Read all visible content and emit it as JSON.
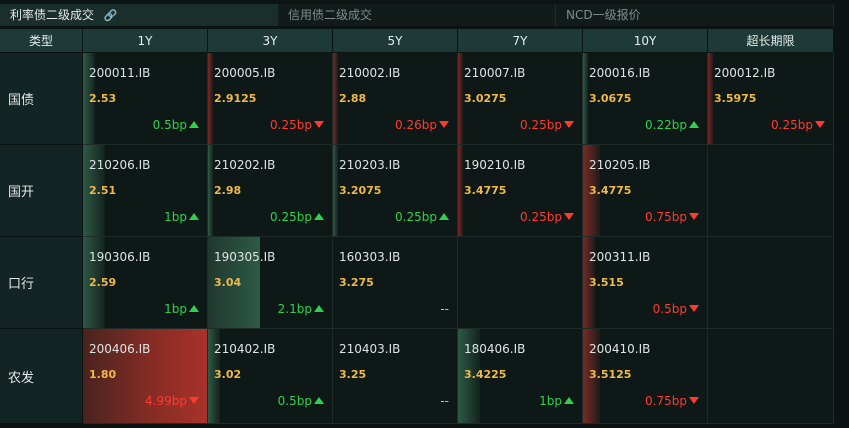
{
  "tabs": [
    {
      "label": "利率债二级成交",
      "active": true,
      "icon": "link-icon"
    },
    {
      "label": "信用债二级成交",
      "active": false
    },
    {
      "label": "NCD一级报价",
      "active": false
    }
  ],
  "columns": [
    "类型",
    "1Y",
    "3Y",
    "5Y",
    "7Y",
    "10Y",
    "超长期限"
  ],
  "rows": [
    {
      "label": "国债",
      "cells": [
        {
          "code": "200011.IB",
          "yield": "2.53",
          "change": "0.5bp",
          "dir": "up",
          "bar": 0.1
        },
        {
          "code": "200005.IB",
          "yield": "2.9125",
          "change": "0.25bp",
          "dir": "down",
          "bar": 0.03
        },
        {
          "code": "210002.IB",
          "yield": "2.88",
          "change": "0.26bp",
          "dir": "down",
          "bar": 0.03
        },
        {
          "code": "210007.IB",
          "yield": "3.0275",
          "change": "0.25bp",
          "dir": "down",
          "bar": 0.03
        },
        {
          "code": "200016.IB",
          "yield": "3.0675",
          "change": "0.22bp",
          "dir": "up",
          "bar": 0.03
        },
        {
          "code": "200012.IB",
          "yield": "3.5975",
          "change": "0.25bp",
          "dir": "down",
          "bar": 0.03
        }
      ]
    },
    {
      "label": "国开",
      "cells": [
        {
          "code": "210206.IB",
          "yield": "2.51",
          "change": "1bp",
          "dir": "up",
          "bar": 0.18
        },
        {
          "code": "210202.IB",
          "yield": "2.98",
          "change": "0.25bp",
          "dir": "up",
          "bar": 0.04
        },
        {
          "code": "210203.IB",
          "yield": "3.2075",
          "change": "0.25bp",
          "dir": "up",
          "bar": 0.04
        },
        {
          "code": "190210.IB",
          "yield": "3.4775",
          "change": "0.25bp",
          "dir": "down",
          "bar": 0.04
        },
        {
          "code": "210205.IB",
          "yield": "3.4775",
          "change": "0.75bp",
          "dir": "down",
          "bar": 0.14
        },
        null
      ]
    },
    {
      "label": "口行",
      "cells": [
        {
          "code": "190306.IB",
          "yield": "2.59",
          "change": "1bp",
          "dir": "up",
          "bar": 0.18
        },
        {
          "code": "190305.IB",
          "yield": "3.04",
          "change": "2.1bp",
          "dir": "up",
          "bar": 0.42
        },
        {
          "code": "160303.IB",
          "yield": "3.275",
          "change": "--",
          "dir": "flat",
          "bar": 0
        },
        null,
        {
          "code": "200311.IB",
          "yield": "3.515",
          "change": "0.5bp",
          "dir": "down",
          "bar": 0.1
        },
        null
      ]
    },
    {
      "label": "农发",
      "cells": [
        {
          "code": "200406.IB",
          "yield": "1.80",
          "change": "4.99bp",
          "dir": "down",
          "bar": 1.0
        },
        {
          "code": "210402.IB",
          "yield": "3.02",
          "change": "0.5bp",
          "dir": "up",
          "bar": 0.1
        },
        {
          "code": "210403.IB",
          "yield": "3.25",
          "change": "--",
          "dir": "flat",
          "bar": 0
        },
        {
          "code": "180406.IB",
          "yield": "3.4225",
          "change": "1bp",
          "dir": "up",
          "bar": 0.18
        },
        {
          "code": "200410.IB",
          "yield": "3.5125",
          "change": "0.75bp",
          "dir": "down",
          "bar": 0.14
        },
        null
      ]
    }
  ],
  "colors": {
    "up": "#2fd14c",
    "down": "#ff3b30",
    "yield": "#f0b94a",
    "header_bg": "#1d3a36"
  }
}
